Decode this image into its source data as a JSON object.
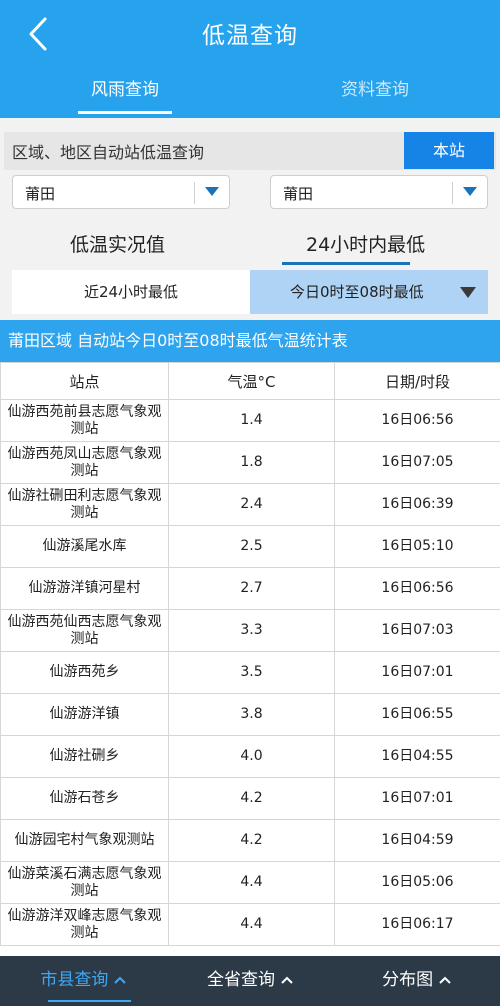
{
  "header": {
    "title": "低温查询",
    "tabs": [
      {
        "label": "风雨查询",
        "active": true
      },
      {
        "label": "资料查询",
        "active": false
      }
    ]
  },
  "query": {
    "label": "区域、地区自动站低温查询",
    "station_button": "本站",
    "region_select": "莆田",
    "area_select": "莆田"
  },
  "subtabs": {
    "left": "低温实况值",
    "right": "24小时内最低"
  },
  "segment": {
    "left": "近24小时最低",
    "right": "今日0时至08时最低"
  },
  "banner": "莆田区域 自动站今日0时至08时最低气温统计表",
  "table": {
    "headers": [
      "站点",
      "气温°C",
      "日期/时段"
    ],
    "rows": [
      {
        "station": "仙游西苑前县志愿气象观测站",
        "temp": "1.4",
        "time": "16日06:56"
      },
      {
        "station": "仙游西苑凤山志愿气象观测站",
        "temp": "1.8",
        "time": "16日07:05"
      },
      {
        "station": "仙游社硎田利志愿气象观测站",
        "temp": "2.4",
        "time": "16日06:39"
      },
      {
        "station": "仙游溪尾水库",
        "temp": "2.5",
        "time": "16日05:10"
      },
      {
        "station": "仙游游洋镇河星村",
        "temp": "2.7",
        "time": "16日06:56"
      },
      {
        "station": "仙游西苑仙西志愿气象观测站",
        "temp": "3.3",
        "time": "16日07:03"
      },
      {
        "station": "仙游西苑乡",
        "temp": "3.5",
        "time": "16日07:01"
      },
      {
        "station": "仙游游洋镇",
        "temp": "3.8",
        "time": "16日06:55"
      },
      {
        "station": "仙游社硎乡",
        "temp": "4.0",
        "time": "16日04:55"
      },
      {
        "station": "仙游石苍乡",
        "temp": "4.2",
        "time": "16日07:01"
      },
      {
        "station": "仙游园宅村气象观测站",
        "temp": "4.2",
        "time": "16日04:59"
      },
      {
        "station": "仙游菜溪石满志愿气象观测站",
        "temp": "4.4",
        "time": "16日05:06"
      },
      {
        "station": "仙游游洋双峰志愿气象观测站",
        "temp": "4.4",
        "time": "16日06:17"
      }
    ]
  },
  "bottom_nav": [
    {
      "label": "市县查询",
      "icon": "chevron-up-icon",
      "active": true
    },
    {
      "label": "全省查询",
      "icon": "chevron-up-icon",
      "active": false
    },
    {
      "label": "分布图",
      "icon": "chevron-up-icon",
      "active": false
    }
  ],
  "colors": {
    "header": "#27a3ee",
    "accent": "#1684e6",
    "nav_bg": "#2c3a48",
    "segment_selected": "#aed3f5"
  }
}
